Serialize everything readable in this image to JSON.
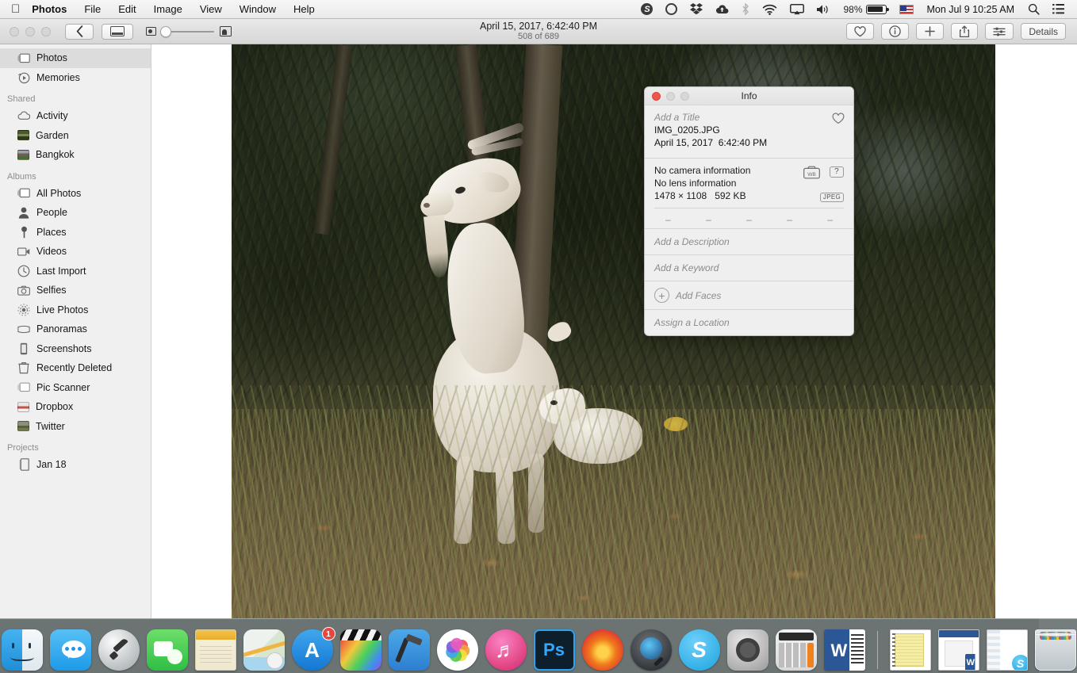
{
  "menubar": {
    "apple_icon": "apple-logo-icon",
    "items": [
      "Photos",
      "File",
      "Edit",
      "Image",
      "View",
      "Window",
      "Help"
    ],
    "status_icons": [
      "skype-icon",
      "creative-cloud-icon",
      "dropbox-icon",
      "cloud-upload-icon",
      "bluetooth-icon",
      "wifi-icon",
      "airplay-icon",
      "volume-icon"
    ],
    "battery_percent": "98%",
    "input_flag": "us-flag-icon",
    "clock": "Mon Jul 9  10:25 AM",
    "search_icon": "search-icon",
    "list_icon": "notification-center-icon"
  },
  "toolbar": {
    "back_icon": "chevron-left-icon",
    "sidebar_icon": "sidebar-toggle-icon",
    "zoom_small_icon": "small-thumbnail-icon",
    "zoom_large_icon": "large-thumbnail-icon",
    "title": "April 15, 2017, 6:42:40 PM",
    "subtitle": "508 of 689",
    "favorite_icon": "heart-icon",
    "info_icon": "info-circle-icon",
    "add_icon": "plus-icon",
    "share_icon": "share-icon",
    "adjust_icon": "adjust-sliders-icon",
    "details_label": "Details"
  },
  "sidebar": {
    "top_items": [
      {
        "label": "Photos",
        "icon": "photos-icon",
        "selected": true
      },
      {
        "label": "Memories",
        "icon": "memories-icon",
        "selected": false
      }
    ],
    "shared_header": "Shared",
    "shared_items": [
      {
        "label": "Activity",
        "icon": "cloud-icon"
      },
      {
        "label": "Garden",
        "icon": "album-thumbnail-garden"
      },
      {
        "label": "Bangkok",
        "icon": "album-thumbnail-bangkok"
      }
    ],
    "albums_header": "Albums",
    "album_items": [
      {
        "label": "All Photos",
        "icon": "photos-icon"
      },
      {
        "label": "People",
        "icon": "person-icon"
      },
      {
        "label": "Places",
        "icon": "map-pin-icon"
      },
      {
        "label": "Videos",
        "icon": "video-camera-icon"
      },
      {
        "label": "Last Import",
        "icon": "clock-icon"
      },
      {
        "label": "Selfies",
        "icon": "camera-icon"
      },
      {
        "label": "Live Photos",
        "icon": "live-photo-icon"
      },
      {
        "label": "Panoramas",
        "icon": "panorama-icon"
      },
      {
        "label": "Screenshots",
        "icon": "screenshot-icon"
      },
      {
        "label": "Recently Deleted",
        "icon": "trash-icon"
      },
      {
        "label": "Pic Scanner",
        "icon": "photos-icon"
      },
      {
        "label": "Dropbox",
        "icon": "album-thumbnail-dropbox"
      },
      {
        "label": "Twitter",
        "icon": "album-thumbnail-twitter"
      }
    ],
    "projects_header": "Projects",
    "project_items": [
      {
        "label": "Jan 18",
        "icon": "book-icon"
      }
    ]
  },
  "photo": {
    "alt": "white goat standing on a grassy hillside with dense vegetation"
  },
  "info_panel": {
    "window_title": "Info",
    "close_icon": "close-icon",
    "title_placeholder": "Add a Title",
    "filename": "IMG_0205.JPG",
    "date": "April 15, 2017",
    "time": "6:42:40 PM",
    "favorite_icon": "heart-icon",
    "camera_info": "No camera information",
    "lens_info": "No lens information",
    "dimensions": "1478 × 1108",
    "filesize": "592 KB",
    "camera_wb_icon": "camera-whitebalance-icon",
    "help_badge": "?",
    "format_badge": "JPEG",
    "exif_values": [
      "–",
      "–",
      "–",
      "–",
      "–"
    ],
    "description_placeholder": "Add a Description",
    "keyword_placeholder": "Add a Keyword",
    "add_faces_label": "Add Faces",
    "add_faces_icon": "plus-circle-icon",
    "location_placeholder": "Assign a Location"
  },
  "dock": {
    "items": [
      {
        "name": "finder",
        "label": "Finder",
        "running": true,
        "badge": null
      },
      {
        "name": "messages",
        "label": "Messages",
        "running": true,
        "badge": null
      },
      {
        "name": "launchpad",
        "label": "Launchpad",
        "running": false,
        "badge": null
      },
      {
        "name": "facetime",
        "label": "FaceTime",
        "running": false,
        "badge": null
      },
      {
        "name": "notes",
        "label": "Notes",
        "running": false,
        "badge": null
      },
      {
        "name": "maps",
        "label": "Maps",
        "running": false,
        "badge": null
      },
      {
        "name": "app-store",
        "label": "App Store",
        "running": false,
        "badge": "1"
      },
      {
        "name": "final-cut-pro",
        "label": "Final Cut Pro",
        "running": false,
        "badge": null
      },
      {
        "name": "xcode",
        "label": "Xcode",
        "running": false,
        "badge": null
      },
      {
        "name": "photos",
        "label": "Photos",
        "running": true,
        "badge": null
      },
      {
        "name": "itunes",
        "label": "iTunes",
        "running": false,
        "badge": null
      },
      {
        "name": "photoshop",
        "label": "Photoshop",
        "running": true,
        "badge": null
      },
      {
        "name": "firefox",
        "label": "Firefox",
        "running": true,
        "badge": null
      },
      {
        "name": "quicktime",
        "label": "QuickTime Player",
        "running": false,
        "badge": null
      },
      {
        "name": "skype",
        "label": "Skype",
        "running": true,
        "badge": null
      },
      {
        "name": "system-preferences",
        "label": "System Preferences",
        "running": false,
        "badge": null
      },
      {
        "name": "calculator",
        "label": "Calculator",
        "running": false,
        "badge": null
      },
      {
        "name": "microsoft-word",
        "label": "Microsoft Word",
        "running": true,
        "badge": null
      }
    ],
    "minimized": [
      {
        "name": "minimized-notes-window",
        "label": "Notes document"
      },
      {
        "name": "minimized-word-window",
        "label": "Word document"
      },
      {
        "name": "minimized-skype-window",
        "label": "Skype window"
      }
    ],
    "trash": {
      "name": "trash",
      "label": "Trash"
    }
  },
  "colors": {
    "menubar_bg": "#eeeeee",
    "sidebar_bg": "#f0f0f0",
    "selection": "#dcdcdc",
    "close_red": "#f0554c",
    "badge_red": "#e8453c",
    "dock_bg": "rgba(130,140,140,0.82)"
  }
}
